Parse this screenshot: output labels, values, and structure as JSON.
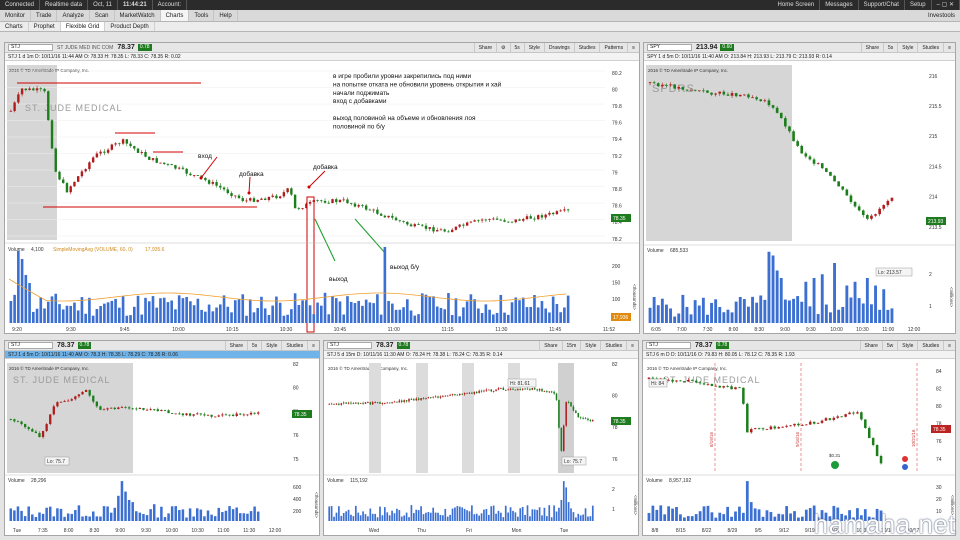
{
  "status": {
    "connected": "Connected",
    "data_mode": "Realtime data",
    "date": "Oct, 11",
    "time": "11:44:21",
    "account": "Account:",
    "right_items": [
      "Home Screen",
      "Messages",
      "Support/Chat",
      "Setup"
    ]
  },
  "nav": {
    "tabs": [
      "Monitor",
      "Trade",
      "Analyze",
      "Scan",
      "MarketWatch",
      "Charts",
      "Tools",
      "Help"
    ],
    "active": "Charts",
    "right": "Investools"
  },
  "subnav": {
    "tabs": [
      "Charts",
      "Prophet",
      "Flexible Grid",
      "Product Depth"
    ],
    "active": "Flexible Grid"
  },
  "copyright": "2016 © TD Ameritrade IP Company, Inc.",
  "pane_main": {
    "symbol": "STJ",
    "last": "78.37",
    "change": "0.78",
    "desc": "ST JUDE MED INC COM",
    "tools": [
      "Share",
      "5s",
      "Style",
      "Drawings",
      "Studies",
      "Patterns"
    ],
    "info": "STJ 1 d 1m  D: 10/11/16 11:44 AM  O: 78.33  H: 78.35  L: 78.33  C: 78.35  R: 0.02",
    "watermark": "ST. JUDE MEDICAL",
    "price_label": "78.35",
    "volume_label": "Volume",
    "volume_value": "4,100",
    "study": "SimpleMovingAvg (VOLUME, 60, 0)",
    "study_value": "17,935.6",
    "volume_flag": "17,936",
    "axis_unit": "<thousands>",
    "notes": [
      "в игре пробили уровни закрепились под ними",
      "на попытке отката не обновили уровень открытия и хай",
      "начали поджимать",
      "вход с добавками",
      "",
      "выход половиной на объеме и обновления лоя",
      "половиной по б/у"
    ],
    "labels": {
      "entry": "вход",
      "add1": "добавка",
      "add2": "добавка",
      "exit": "выход",
      "exit_be": "выход б/у"
    },
    "chart_data": {
      "type": "candlestick",
      "y_ticks": [
        "80.2",
        "80",
        "79.8",
        "79.6",
        "79.4",
        "79.2",
        "79",
        "78.8",
        "78.6",
        "78.4",
        "78.2"
      ],
      "x_ticks": [
        "9:20",
        "9:30",
        "9:45",
        "10:00",
        "10:15",
        "10:30",
        "10:45",
        "11:00",
        "11:15",
        "11:30",
        "11:45",
        "11:52"
      ],
      "vol_ticks": [
        "200",
        "150",
        "100",
        "50"
      ]
    }
  },
  "pane_spy": {
    "symbol": "SPY",
    "last": "213.94",
    "change": "0.60",
    "tools": [
      "Share",
      "5s",
      "Style",
      "Studies"
    ],
    "info": "SPY 1 d 5m  D: 10/11/16 11:40 AM  O: 213.84  H: 213.93  L: 213.79  C: 213.93  R: 0.14",
    "watermark": "SPDRS",
    "price_label": "213.93",
    "low_label": "Lo: 213.57",
    "volume_label": "Volume",
    "volume_value": "685,533",
    "axis_unit": "<millions>",
    "chart_data": {
      "type": "candlestick",
      "y_ticks": [
        "216",
        "215.5",
        "215",
        "214.5",
        "214",
        "213.5"
      ],
      "x_ticks": [
        "6:05",
        "7:00",
        "7:30",
        "8:00",
        "8:30",
        "9:00",
        "9:30",
        "10:00",
        "10:30",
        "11:00",
        "12:00"
      ],
      "vol_ticks": [
        "2",
        "1"
      ]
    }
  },
  "pane_bl": {
    "symbol": "STJ",
    "last": "78.37",
    "change": "0.78",
    "tools": [
      "Share",
      "5s",
      "Style",
      "Studies"
    ],
    "info": "STJ 1 d 5m  D: 10/11/16 11:40 AM  O: 78.3  H: 78.35  L: 78.29  C: 78.35  R: 0.06",
    "watermark": "ST. JUDE MEDICAL",
    "price_label": "78.35",
    "low_label": "Lo: 75.7",
    "volume_label": "Volume",
    "volume_value": "28,296",
    "axis_unit": "<thousands>",
    "chart_data": {
      "type": "candlestick",
      "y_ticks": [
        "82",
        "80",
        "78",
        "76",
        "75"
      ],
      "x_ticks": [
        "Tue",
        "7:35",
        "8:00",
        "8:30",
        "9:00",
        "9:30",
        "10:00",
        "10:30",
        "11:00",
        "11:30",
        "12:00"
      ],
      "vol_ticks": [
        "600",
        "400",
        "200"
      ]
    }
  },
  "pane_bm": {
    "symbol": "STJ",
    "last": "78.37",
    "change": "0.78",
    "tools": [
      "Share",
      "15m",
      "Style",
      "Studies"
    ],
    "info": "STJ 5 d 15m  D: 10/11/16 11:30 AM  O: 78.24  H: 78.38  L: 78.24  C: 78.35  R: 0.14",
    "price_label": "78.35",
    "hi_label": "Hi: 81.61",
    "low_label": "Lo: 75.7",
    "volume_label": "Volume",
    "volume_value": "115,192",
    "axis_unit": "<millions>",
    "chart_data": {
      "type": "candlestick",
      "y_ticks": [
        "82",
        "80",
        "78",
        "76"
      ],
      "x_ticks": [
        "Wed",
        "Thu",
        "Fri",
        "Mon",
        "Tue"
      ],
      "vol_ticks": [
        "2",
        "1"
      ]
    }
  },
  "pane_br": {
    "symbol": "STJ",
    "last": "78.37",
    "change": "0.78",
    "tools": [
      "Share",
      "5w",
      "Style",
      "Studies"
    ],
    "info": "STJ 6 m D  D: 10/11/16  O: 79.83  H: 80.05  L: 78.12  C: 78.35  R: 1.93",
    "watermark": "ST. JUDE MEDICAL",
    "price_label": "78.35",
    "hi_label": "Hi: 84",
    "event_value": "$0.31",
    "volume_label": "Volume",
    "volume_value": "8,957,192",
    "axis_unit": "<millions>",
    "date_markers": [
      "8/19/16",
      "9/16/16",
      "10/21/16"
    ],
    "chart_data": {
      "type": "candlestick",
      "y_ticks": [
        "84",
        "82",
        "80",
        "78",
        "76",
        "74"
      ],
      "x_ticks": [
        "8/8",
        "8/15",
        "8/22",
        "8/29",
        "9/5",
        "9/12",
        "9/19",
        "9/26",
        "10/3",
        "10/10",
        "10/17"
      ],
      "vol_ticks": [
        "30",
        "20",
        "10"
      ]
    }
  },
  "brand": "hamaha.net",
  "colors": {
    "up": "#1b7e1b",
    "down": "#b01c1c",
    "volume": "#3b6fd1",
    "sma": "#f0a030",
    "price_tag": "#1e7b1e",
    "annotation": "#d00000",
    "arrow_green": "#1fa02f"
  }
}
